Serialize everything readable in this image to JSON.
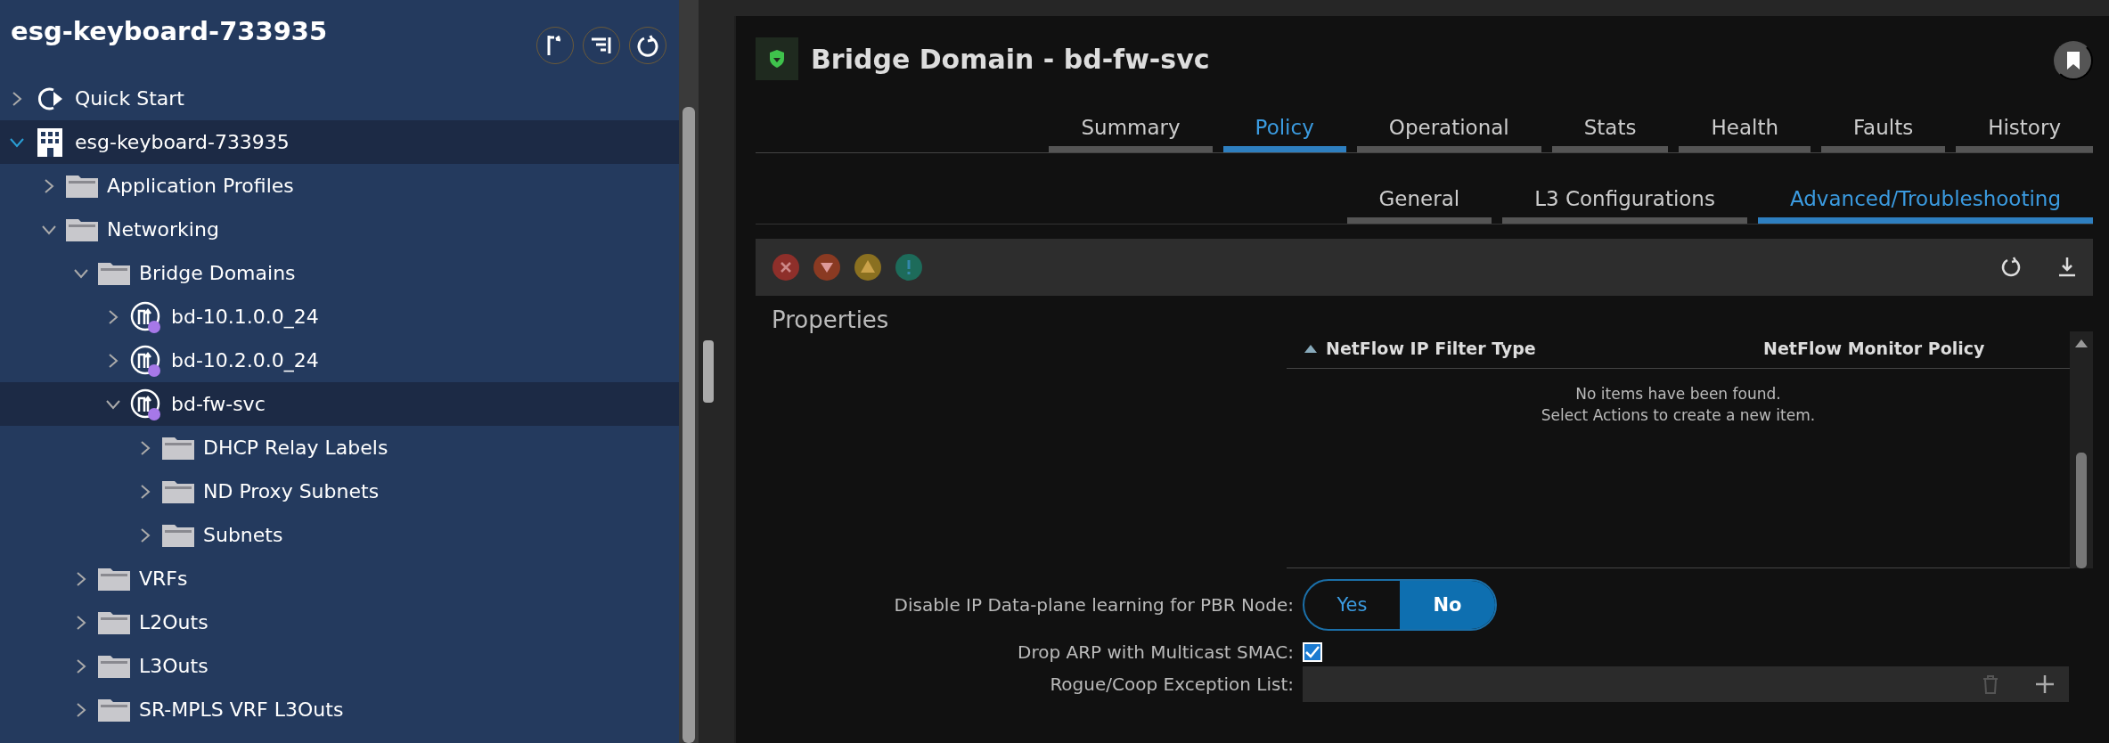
{
  "sidebar": {
    "title": "esg-keyboard-733935",
    "tree": [
      {
        "label": "Quick Start",
        "kind": "quickstart",
        "expanded": false,
        "selected": false
      },
      {
        "label": "esg-keyboard-733935",
        "kind": "tenant",
        "expanded": true,
        "selected": true,
        "children": [
          {
            "label": "Application Profiles",
            "kind": "folder",
            "expanded": false,
            "selected": false
          },
          {
            "label": "Networking",
            "kind": "folder",
            "expanded": true,
            "selected": false,
            "children": [
              {
                "label": "Bridge Domains",
                "kind": "folder",
                "expanded": true,
                "selected": false,
                "children": [
                  {
                    "label": "bd-10.1.0.0_24",
                    "kind": "bd",
                    "expanded": false,
                    "selected": false
                  },
                  {
                    "label": "bd-10.2.0.0_24",
                    "kind": "bd",
                    "expanded": false,
                    "selected": false
                  },
                  {
                    "label": "bd-fw-svc",
                    "kind": "bd",
                    "expanded": true,
                    "selected": true,
                    "children": [
                      {
                        "label": "DHCP Relay Labels",
                        "kind": "folder",
                        "expanded": false,
                        "selected": false
                      },
                      {
                        "label": "ND Proxy Subnets",
                        "kind": "folder",
                        "expanded": false,
                        "selected": false
                      },
                      {
                        "label": "Subnets",
                        "kind": "folder",
                        "expanded": false,
                        "selected": false
                      }
                    ]
                  }
                ]
              },
              {
                "label": "VRFs",
                "kind": "folder",
                "expanded": false,
                "selected": false
              },
              {
                "label": "L2Outs",
                "kind": "folder",
                "expanded": false,
                "selected": false
              },
              {
                "label": "L3Outs",
                "kind": "folder",
                "expanded": false,
                "selected": false
              },
              {
                "label": "SR-MPLS VRF L3Outs",
                "kind": "folder",
                "expanded": false,
                "selected": false
              }
            ]
          }
        ]
      }
    ]
  },
  "content": {
    "title": "Bridge Domain - bd-fw-svc",
    "tabs": [
      {
        "label": "Summary",
        "selected": false
      },
      {
        "label": "Policy",
        "selected": true
      },
      {
        "label": "Operational",
        "selected": false
      },
      {
        "label": "Stats",
        "selected": false
      },
      {
        "label": "Health",
        "selected": false
      },
      {
        "label": "Faults",
        "selected": false
      },
      {
        "label": "History",
        "selected": false
      }
    ],
    "subtabs": [
      {
        "label": "General",
        "selected": false
      },
      {
        "label": "L3 Configurations",
        "selected": false
      },
      {
        "label": "Advanced/Troubleshooting",
        "selected": true
      }
    ],
    "fault_filters": [
      {
        "kind": "critical"
      },
      {
        "kind": "major"
      },
      {
        "kind": "minor"
      },
      {
        "kind": "warning"
      }
    ],
    "section": "Properties",
    "table": {
      "columns": [
        "NetFlow IP Filter Type",
        "NetFlow Monitor Policy"
      ],
      "empty_message": [
        "No items have been found.",
        "Select Actions to create a new item."
      ]
    },
    "fields": [
      {
        "kind": "toggle",
        "label": "Disable IP Data-plane learning for PBR Node:",
        "options": [
          {
            "label": "Yes",
            "selected": false
          },
          {
            "label": "No",
            "selected": true
          }
        ]
      },
      {
        "kind": "checkbox",
        "label": "Drop ARP with Multicast SMAC:",
        "checked": true
      },
      {
        "kind": "list",
        "label": "Rogue/Coop Exception List:"
      }
    ]
  }
}
